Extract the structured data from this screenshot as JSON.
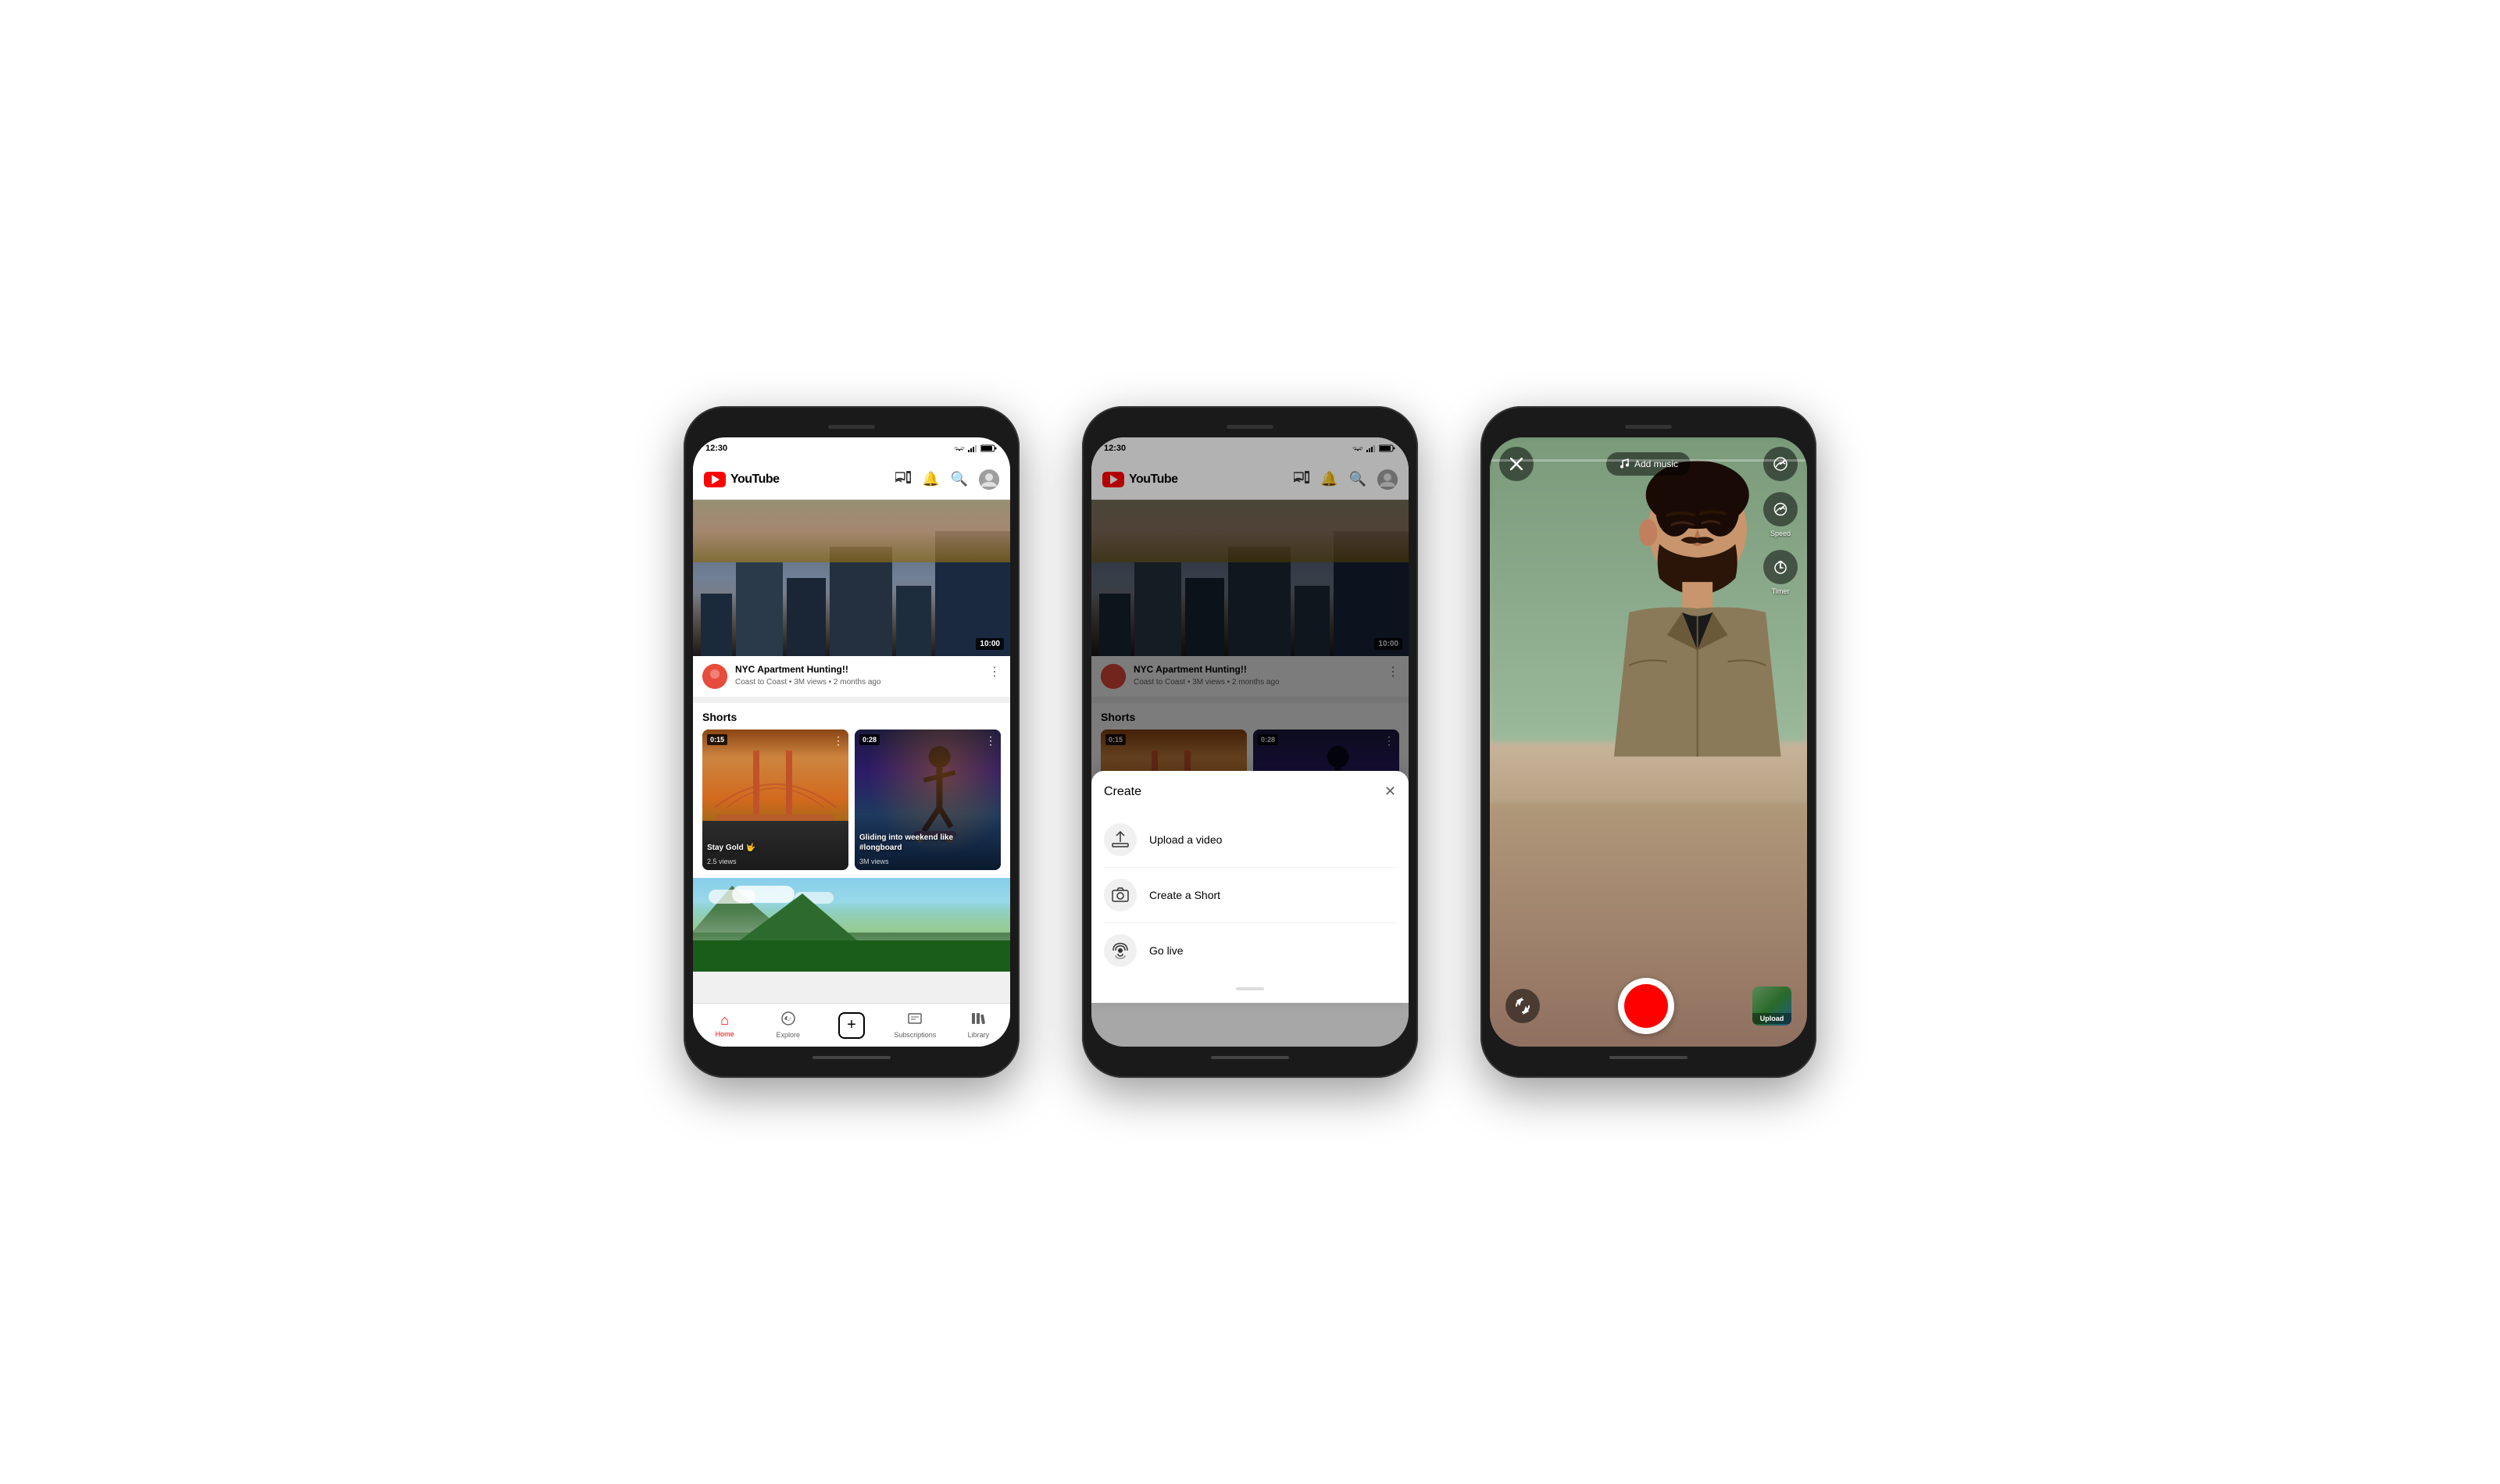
{
  "phones": [
    {
      "id": "phone1",
      "statusBar": {
        "time": "12:30",
        "icons": "▼◀▲"
      },
      "header": {
        "logoText": "YouTube",
        "icons": [
          "cast",
          "bell",
          "search",
          "avatar"
        ]
      },
      "video": {
        "duration": "10:00",
        "title": "NYC Apartment Hunting!!",
        "subtitle": "Coast to Coast • 3M views • 2 months ago"
      },
      "shorts": {
        "sectionTitle": "Shorts",
        "items": [
          {
            "duration": "0:15",
            "label": "Stay Gold 🤟",
            "views": "2.5 views",
            "type": "golden-gate"
          },
          {
            "duration": "0:28",
            "label": "Gliding into weekend like #longboard",
            "views": "3M views",
            "type": "silhouette"
          }
        ]
      },
      "nav": {
        "items": [
          {
            "icon": "🏠",
            "label": "Home",
            "active": true
          },
          {
            "icon": "🧭",
            "label": "Explore",
            "active": false
          },
          {
            "icon": "+",
            "label": "",
            "active": false,
            "isPlus": true
          },
          {
            "icon": "☰",
            "label": "Subscriptions",
            "active": false
          },
          {
            "icon": "📁",
            "label": "Library",
            "active": false
          }
        ]
      }
    },
    {
      "id": "phone2",
      "statusBar": {
        "time": "12:30"
      },
      "header": {
        "logoText": "YouTube"
      },
      "video": {
        "duration": "10:00",
        "title": "NYC Apartment Hunting!!",
        "subtitle": "Coast to Coast • 3M views • 2 months ago"
      },
      "shorts": {
        "sectionTitle": "Shorts",
        "items": [
          {
            "duration": "0:15",
            "type": "golden-gate"
          },
          {
            "duration": "0:28",
            "type": "silhouette"
          }
        ]
      },
      "createModal": {
        "title": "Create",
        "items": [
          {
            "icon": "⬆",
            "label": "Upload a video"
          },
          {
            "icon": "📷",
            "label": "Create a Short"
          },
          {
            "icon": "📡",
            "label": "Go live"
          }
        ]
      }
    },
    {
      "id": "phone3",
      "camera": {
        "addMusicLabel": "Add music",
        "speedLabel": "Speed",
        "timerLabel": "Timer",
        "uploadLabel": "Upload",
        "progressWidth": "0"
      }
    }
  ]
}
